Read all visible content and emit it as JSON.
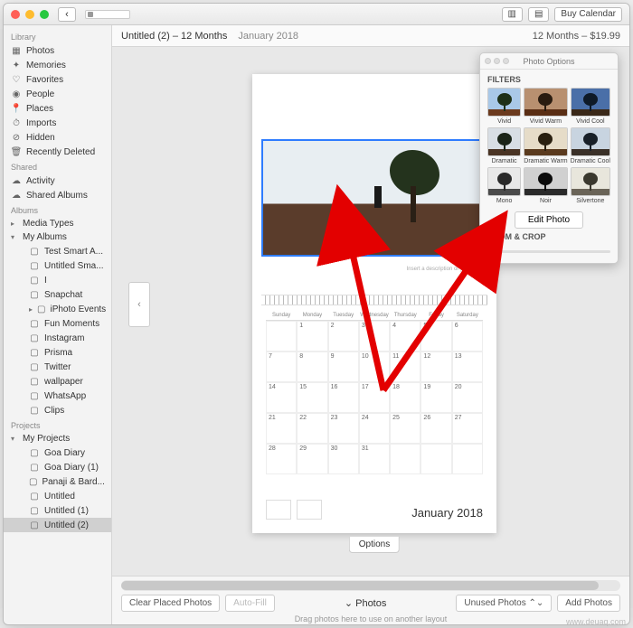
{
  "titlebar": {
    "buy_label": "Buy Calendar"
  },
  "subheader": {
    "title": "Untitled (2) – 12 Months",
    "month": "January 2018",
    "right": "12 Months – $19.99"
  },
  "sidebar": {
    "library_head": "Library",
    "library": [
      "Photos",
      "Memories",
      "Favorites",
      "People",
      "Places",
      "Imports",
      "Hidden",
      "Recently Deleted"
    ],
    "shared_head": "Shared",
    "shared": [
      "Activity",
      "Shared Albums"
    ],
    "albums_head": "Albums",
    "media_types": "Media Types",
    "my_albums": "My Albums",
    "albums": [
      "Test Smart A...",
      "Untitled Sma...",
      "I",
      "Snapchat",
      "iPhoto Events",
      "Fun Moments",
      "Instagram",
      "Prisma",
      "Twitter",
      "wallpaper",
      "WhatsApp",
      "Clips"
    ],
    "projects_head": "Projects",
    "my_projects": "My Projects",
    "projects": [
      "Goa Diary",
      "Goa Diary (1)",
      "Panaji & Bard...",
      "Untitled",
      "Untitled (1)",
      "Untitled (2)"
    ]
  },
  "calendar": {
    "description_hint": "Insert a description of your photo",
    "days": [
      "Sunday",
      "Monday",
      "Tuesday",
      "Wednesday",
      "Thursday",
      "Friday",
      "Saturday"
    ],
    "month_label": "January 2018",
    "options_btn": "Options"
  },
  "popover": {
    "title": "Photo Options",
    "filters_label": "FILTERS",
    "filters": [
      {
        "name": "Vivid",
        "sky": "#a9c8e8",
        "ground": "#6b3a1e",
        "tree": "#1e3018"
      },
      {
        "name": "Vivid Warm",
        "sky": "#b89070",
        "ground": "#5a2e14",
        "tree": "#2a1c10"
      },
      {
        "name": "Vivid Cool",
        "sky": "#4a6fa8",
        "ground": "#3a2818",
        "tree": "#0e1a28"
      },
      {
        "name": "Dramatic",
        "sky": "#d8dee4",
        "ground": "#4a3424",
        "tree": "#1a2418"
      },
      {
        "name": "Dramatic Warm",
        "sky": "#e6dcc8",
        "ground": "#5a3a1e",
        "tree": "#2a2010"
      },
      {
        "name": "Dramatic Cool",
        "sky": "#c8d4e0",
        "ground": "#3a3028",
        "tree": "#182028"
      },
      {
        "name": "Mono",
        "sky": "#e8e8e8",
        "ground": "#4a4a4a",
        "tree": "#2a2a2a"
      },
      {
        "name": "Noir",
        "sky": "#d0d0d0",
        "ground": "#2a2a2a",
        "tree": "#0a0a0a"
      },
      {
        "name": "Silvertone",
        "sky": "#e8e6dc",
        "ground": "#6a6458",
        "tree": "#3a382e"
      }
    ],
    "edit_label": "Edit Photo",
    "zoom_label": "ZOOM & CROP"
  },
  "bottom": {
    "clear": "Clear Placed Photos",
    "autofill": "Auto-Fill",
    "photos": "Photos",
    "unused": "Unused Photos",
    "add": "Add Photos",
    "hint": "Drag photos here to use on another layout"
  },
  "watermark": "www.deuaq.com"
}
